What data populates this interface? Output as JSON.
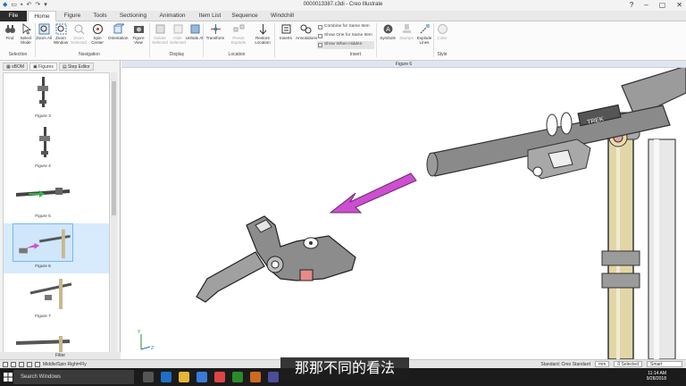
{
  "titlebar": {
    "title": "0000013387.c3di - Creo Illustrate"
  },
  "tabs": [
    {
      "label": "File"
    },
    {
      "label": "Home"
    },
    {
      "label": "Figure"
    },
    {
      "label": "Tools"
    },
    {
      "label": "Sectioning"
    },
    {
      "label": "Animation"
    },
    {
      "label": "Item List"
    },
    {
      "label": "Sequence"
    },
    {
      "label": "Windchill"
    }
  ],
  "ribbon": {
    "buttons": [
      {
        "label": "Find",
        "icon": "binoculars-icon"
      },
      {
        "label": "Select Mode",
        "icon": "cursor-icon"
      },
      {
        "label": "Zoom All",
        "icon": "zoom-all-icon"
      },
      {
        "label": "Zoom Window",
        "icon": "zoom-window-icon"
      },
      {
        "label": "Zoom Selected",
        "icon": "zoom-selected-icon"
      },
      {
        "label": "Spin Center",
        "icon": "spin-center-icon"
      },
      {
        "label": "Orientation",
        "icon": "orientation-icon"
      },
      {
        "label": "Figure View",
        "icon": "figure-view-icon"
      },
      {
        "label": "Isolate Selected",
        "icon": "isolate-icon"
      },
      {
        "label": "Hide Selected",
        "icon": "hide-icon"
      },
      {
        "label": "Unhide All",
        "icon": "unhide-icon"
      },
      {
        "label": "Transform",
        "icon": "transform-icon"
      },
      {
        "label": "Preset Explode",
        "icon": "explode-icon"
      },
      {
        "label": "Restore Location",
        "icon": "restore-icon"
      },
      {
        "label": "Inserts",
        "icon": "inserts-icon"
      },
      {
        "label": "Annotations",
        "icon": "annotations-icon"
      },
      {
        "label": "Symbols",
        "icon": "symbols-icon"
      },
      {
        "label": "Stamps",
        "icon": "stamps-icon"
      },
      {
        "label": "Explode Lines",
        "icon": "explode-lines-icon"
      },
      {
        "label": "Color",
        "icon": "color-icon"
      }
    ],
    "options": {
      "combine": "Combine for Same Item",
      "show_one": "Show One for Same Item",
      "show_hidden": "Show When Hidden"
    },
    "groups": {
      "selection": "Selection",
      "navigation": "Navigation",
      "display": "Display",
      "location": "Location",
      "insert": "Insert",
      "style": "Style"
    }
  },
  "leftpane": {
    "tabs": [
      {
        "label": "sBOM"
      },
      {
        "label": "Figures"
      },
      {
        "label": "Step Editor"
      }
    ],
    "figures": [
      {
        "caption": "Figure 3"
      },
      {
        "caption": "Figure 4"
      },
      {
        "caption": "Figure 5"
      },
      {
        "caption": "Figure 6"
      },
      {
        "caption": "Figure 7"
      },
      {
        "caption": ""
      }
    ],
    "filter_label": "Filter"
  },
  "view": {
    "header": "Figure 6",
    "triad": {
      "y": "Y",
      "z": "Z"
    },
    "decal": "TREK"
  },
  "statusbar": {
    "mode": "Middle/Spin  Right=Fly",
    "standard": "Standard: Creo Standard",
    "units": "mm",
    "selected": "0 Selected",
    "filter": "Smart"
  },
  "taskbar": {
    "search_placeholder": "Search Windows",
    "time": "11:14 AM",
    "date": "9/28/2018"
  },
  "subtitle": "那那不同的看法",
  "colors": {
    "accent": "#1f6fc5",
    "arrow": "#cc4fd0",
    "stanchion": "#e2d6a6",
    "bike_frame": "#9b9b9b",
    "lever_body": "#8c8c8c",
    "reservoir_cap": "#e78a8a"
  }
}
